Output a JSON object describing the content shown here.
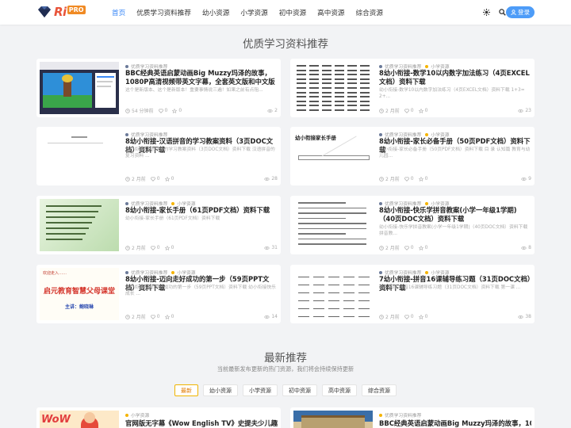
{
  "header": {
    "logo_text": "Ri",
    "logo_badge": "PRO",
    "nav": [
      {
        "label": "首页",
        "active": true
      },
      {
        "label": "优质学习资料推荐"
      },
      {
        "label": "幼小资源"
      },
      {
        "label": "小学资源"
      },
      {
        "label": "初中资源"
      },
      {
        "label": "高中资源"
      },
      {
        "label": "综合资源"
      }
    ],
    "login_label": "登录"
  },
  "featured": {
    "title": "优质学习资料推荐",
    "cards": [
      {
        "cat1": "优质学习资料推荐",
        "cat2": "",
        "title": "BBC经典英语启蒙动画Big Muzzy玛泽的故事，1080P高清视频带英文字幕，全套英文版和中文版+游...",
        "desc": "这个是新版本、这个是新版本！重要事情说三遍！如果之前有点阻...",
        "time": "54 分钟前",
        "likes": "0",
        "comments": "0",
        "views": "2"
      },
      {
        "cat1": "优质学习资料推荐",
        "cat2": "小学资源",
        "title": "8幼小衔接-数学10以内数字加法练习（4页EXCEL文档）资料下载",
        "desc": "幼小衔接-数学10以内数字加法练习（4页EXCEL文档）资料下载 1+3= 2+...",
        "time": "2 月前",
        "likes": "0",
        "comments": "0",
        "views": "23"
      },
      {
        "cat1": "优质学习资料推荐",
        "cat2": "",
        "title": "8幼小衔接-汉语拼音的学习教案资料（3页DOC文档）资料下载",
        "desc": "幼小衔接-汉语拼音的学习教案资料（3页DOC文档）资料下载 汉语拼音的复习资料 ...",
        "time": "2 月前",
        "likes": "0",
        "comments": "0",
        "views": "28"
      },
      {
        "cat1": "优质学习资料推荐",
        "cat2": "小学资源",
        "title": "8幼小衔接-家长必备手册（50页PDF文档）资料下载",
        "desc": "幼小衔接-家长必备手册（50页PDF文档）资料下载 目 录 认知篇 教育与幼儿园...",
        "time": "2 月前",
        "likes": "0",
        "comments": "0",
        "views": "9"
      },
      {
        "cat1": "优质学习资料推荐",
        "cat2": "小学资源",
        "title": "8幼小衔接-家长手册（61页PDF文档）资料下载",
        "desc": "幼小衔接-家长手册（61页PDF文档）资料下载",
        "time": "2 月前",
        "likes": "0",
        "comments": "0",
        "views": "31"
      },
      {
        "cat1": "优质学习资料推荐",
        "cat2": "小学资源",
        "title": "8幼小衔接-快乐学拼音教案(小学一年级1学期)（40页DOC文档）资料下载",
        "desc": "幼小衔接-快乐学拼音教案(小学一年级1学期)（40页DOC文档）资料下载 拼音教...",
        "time": "2 月前",
        "likes": "0",
        "comments": "0",
        "views": "8"
      },
      {
        "cat1": "优质学习资料推荐",
        "cat2": "小学资源",
        "title": "8幼小衔接-迈向走好成功的第一步（59页PPT文档）资料下载",
        "desc": "幼小衔接-迈向走好成功的第一步（59页PPT文档）资料下载 幼小衔接快乐成长 ...",
        "time": "2 月前",
        "likes": "0",
        "comments": "0",
        "views": "14"
      },
      {
        "cat1": "优质学习资料推荐",
        "cat2": "小学资源",
        "title": "7幼小衔接-拼音16课辅导练习题（31页DOC文档）资料下载",
        "desc": "幼小衔接-拼音16课辅导练习题（31页DOC文档）资料下载 第一课 ...",
        "time": "2 月前",
        "likes": "0",
        "comments": "0",
        "views": "38"
      }
    ]
  },
  "latest": {
    "title": "最新推荐",
    "subtitle": "当前最新发布更新的热门资源，我们将会持续保持更新",
    "tabs": [
      {
        "label": "最新",
        "active": true
      },
      {
        "label": "幼小资源"
      },
      {
        "label": "小学资源"
      },
      {
        "label": "初中资源"
      },
      {
        "label": "高中资源"
      },
      {
        "label": "综合资源"
      }
    ],
    "cards": [
      {
        "cat": "小学资源",
        "title": "官网版无字幕《Wow English TV》史提夫少儿趣味..."
      },
      {
        "cat": "优质学习资料推荐",
        "title": "BBC经典英语启蒙动画Big Muzzy玛泽的故事，10..."
      }
    ]
  },
  "thumbs": {
    "card7_line1": "启元教育智慧父母课堂",
    "card7_line2": "主讲：鲍晓琳",
    "card7_corner": "欢迎走入……",
    "card4_heading": "幼小衔接家长手册",
    "latest1_logo": "WoW"
  },
  "colors": {
    "accent": "#3d8af7",
    "cat_dot": "#f5b400",
    "tab_active": "#f0b400"
  }
}
